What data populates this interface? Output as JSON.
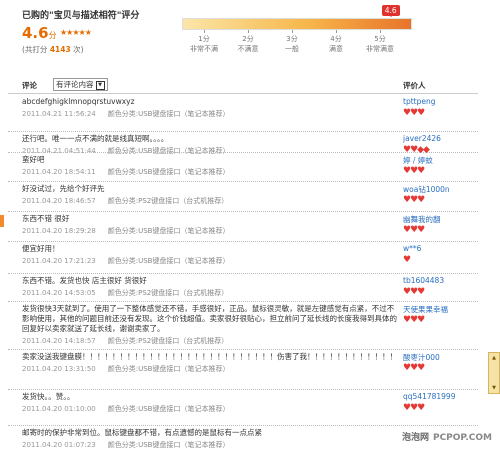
{
  "header": {
    "title": "已购的\"宝贝与描述相符\"评分",
    "score": "4.6",
    "score_unit": "分",
    "stars": "★★★★★",
    "total_prefix": "(共打分 ",
    "total_count": "4143",
    "total_suffix": " 次)",
    "bar_marker": "4.6",
    "bar_fraction": 0.92,
    "ticks": [
      {
        "score": "1分",
        "label": "非常不满"
      },
      {
        "score": "2分",
        "label": "不满意"
      },
      {
        "score": "3分",
        "label": "一般"
      },
      {
        "score": "4分",
        "label": "满意"
      },
      {
        "score": "5分",
        "label": "非常满意"
      }
    ]
  },
  "columns": {
    "review": "评论",
    "filter": "有评论内容",
    "reviewer": "评价人"
  },
  "reviews": [
    {
      "text": "abcdefghigklmnopqrstuvwxyz",
      "date": "2011.04.21 11:56:24",
      "spec": "颜色分类:USB键盘接口（笔记本推荐）",
      "user": "tpttpeng",
      "hearts": "♥♥♥"
    },
    {
      "text": "还行吧。唯一一点不满的就是线真短啊。。。。",
      "date": "2011.04.21 04:51:44",
      "spec": "颜色分类:USB键盘接口（笔记本推荐）",
      "user": "javer2426",
      "hearts": "♥♥◆◆"
    },
    {
      "text": "蛮好吧",
      "date": "2011.04.20 18:54:11",
      "spec": "颜色分类:USB键盘接口（笔记本推荐）",
      "user": "婷 / 婷蚊",
      "hearts": "♥♥♥"
    },
    {
      "text": "好没试过，先给个好评先",
      "date": "2011.04.20 18:46:57",
      "spec": "颜色分类:PS2键盘接口（台式机推荐）",
      "user": "woa钻1000n",
      "hearts": "♥♥♥"
    },
    {
      "text": "东西不错 很好",
      "date": "2011.04.20 18:29:28",
      "spec": "颜色分类:USB键盘接口（笔记本推荐）",
      "user": "幽舞我的翻",
      "hearts": "♥♥♥"
    },
    {
      "text": "便宜好用！",
      "date": "2011.04.20 17:21:23",
      "spec": "颜色分类:USB键盘接口（笔记本推荐）",
      "user": "w**6",
      "hearts": "♥"
    },
    {
      "text": "东西不错。发货也快 店主很好 货很好",
      "date": "2011.04.20 14:53:05",
      "spec": "颜色分类:PS2键盘接口（台式机推荐）",
      "user": "tb1604483",
      "hearts": "♥♥♥"
    },
    {
      "text": "发货很快3天就到了。使用了一下整体感觉还不错，手感很好，正品。鼠标很灵敏，就是左键感觉有点紧，不过不影响使用，其他的问题目前还没有发现。这个价钱超值。卖家很好很贴心，担立前问了延长线的长度我得到具体的回复好以卖家就送了延长线，谢谢卖家了。",
      "date": "2011.04.20 14:18:57",
      "spec": "颜色分类:PS2键盘接口（台式机推荐）",
      "user": "天使果果幸福",
      "hearts": "♥♥♥"
    },
    {
      "text": "卖家没送我键盘膜！！！！！！！！！！！！！！！！！！！！！！！！！！伤害了我！！！！！！！！！！！！",
      "date": "2011.04.20 13:31:50",
      "spec": "颜色分类:USB键盘接口（笔记本推荐）",
      "user": "酸枣汁000",
      "hearts": "♥♥♥"
    },
    {
      "text": "发货快。。赞。。",
      "date": "2011.04.20 01:10:00",
      "spec": "颜色分类:USB键盘接口（笔记本推荐）",
      "user": "qq541781999",
      "hearts": "♥♥♥"
    },
    {
      "text": "邮寄时的保护非常到位。鼠标键盘都不错，有点遗憾的是鼠标有一点点紧",
      "date": "2011.04.20 01:07:23",
      "spec": "颜色分类:USB键盘接口（笔记本推荐）",
      "user": "",
      "hearts": ""
    }
  ],
  "watermark": {
    "cn": "泡泡网",
    "en": "PCPOP.COM"
  }
}
